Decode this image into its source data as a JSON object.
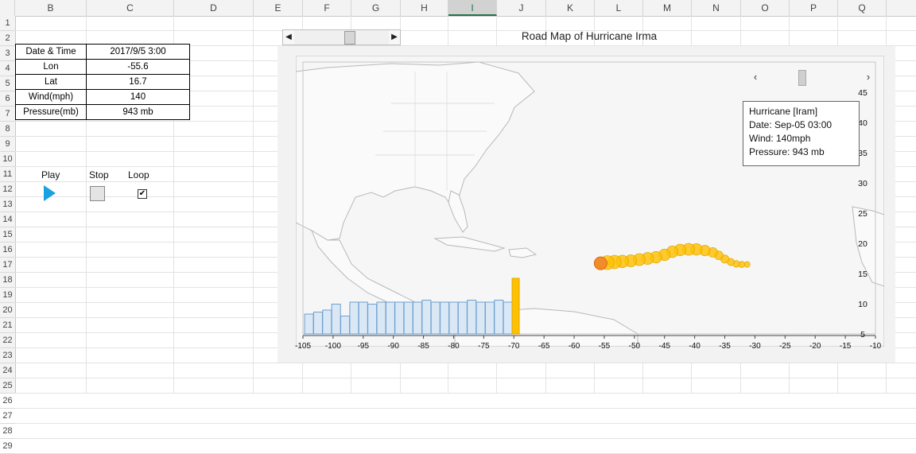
{
  "columns": [
    "B",
    "C",
    "D",
    "E",
    "F",
    "G",
    "H",
    "I",
    "J",
    "K",
    "L",
    "M",
    "N",
    "O",
    "P",
    "Q"
  ],
  "selected_column": "I",
  "rows": [
    "1",
    "2",
    "3",
    "4",
    "5",
    "6",
    "7",
    "8",
    "9",
    "10",
    "11",
    "12",
    "13",
    "14",
    "15",
    "16",
    "17",
    "18",
    "19",
    "20",
    "21",
    "22",
    "23",
    "24",
    "25",
    "26",
    "27",
    "28",
    "29"
  ],
  "info_table": [
    {
      "label": "Date & Time",
      "value": "2017/9/5 3:00"
    },
    {
      "label": "Lon",
      "value": "-55.6"
    },
    {
      "label": "Lat",
      "value": "16.7"
    },
    {
      "label": "Wind(mph)",
      "value": "140"
    },
    {
      "label": "Pressure(mb)",
      "value": "943 mb"
    }
  ],
  "controls": {
    "play_label": "Play",
    "stop_label": "Stop",
    "loop_label": "Loop",
    "loop_checked_glyph": "✔"
  },
  "chart": {
    "title": "Road Map of Hurricane Irma"
  },
  "tooltip": {
    "line1": "Hurricane [Iram]",
    "line2": "Date: Sep-05 03:00",
    "line3": "Wind: 140mph",
    "line4": "Pressure: 943 mb"
  },
  "colors": {
    "track": "#ffc000",
    "current": "#f28c28",
    "bars": "#dae8f5",
    "bar_current": "#ffc000",
    "play": "#1ba1e2"
  },
  "chart_data": {
    "type": "scatter",
    "title": "Road Map of Hurricane Irma",
    "xlim": [
      -105,
      -10
    ],
    "ylim": [
      5,
      50
    ],
    "x_ticks": [
      "-105",
      "-100",
      "-95",
      "-90",
      "-85",
      "-80",
      "-75",
      "-70",
      "-65",
      "-60",
      "-55",
      "-50",
      "-45",
      "-40",
      "-35",
      "-30",
      "-25",
      "-20",
      "-15",
      "-10"
    ],
    "y_ticks": [
      "5",
      "10",
      "15",
      "20",
      "25",
      "30",
      "35",
      "40",
      "45"
    ],
    "series": [
      {
        "points": [
          [
            -31.3,
            16.5
          ],
          [
            -32.2,
            16.5
          ],
          [
            -33.1,
            16.6
          ],
          [
            -34.0,
            16.9
          ],
          [
            -35.0,
            17.4
          ],
          [
            -36.0,
            18.0
          ],
          [
            -37.0,
            18.5
          ],
          [
            -38.3,
            18.8
          ],
          [
            -39.7,
            19.0
          ],
          [
            -41.0,
            19.0
          ],
          [
            -42.4,
            18.9
          ],
          [
            -43.7,
            18.6
          ],
          [
            -45.0,
            18.1
          ],
          [
            -46.4,
            17.7
          ],
          [
            -47.8,
            17.5
          ],
          [
            -49.2,
            17.3
          ],
          [
            -50.6,
            17.1
          ],
          [
            -52.0,
            17.0
          ],
          [
            -53.3,
            16.9
          ],
          [
            -54.5,
            16.8
          ]
        ],
        "sizes_mph": [
          50,
          55,
          60,
          65,
          75,
          80,
          90,
          100,
          110,
          115,
          110,
          110,
          110,
          110,
          115,
          115,
          115,
          120,
          130,
          135
        ]
      }
    ],
    "current": {
      "lon": -55.6,
      "lat": 16.7,
      "wind": 140
    },
    "bars": {
      "x": [
        -104,
        -102.5,
        -101,
        -99.5,
        -98,
        -96.5,
        -95,
        -93.5,
        -92,
        -90.5,
        -89,
        -87.5,
        -86,
        -84.5,
        -83,
        -81.5,
        -80,
        -78.5,
        -77,
        -75.5,
        -74,
        -72.5,
        -71,
        -69.7
      ],
      "values": [
        50,
        55,
        60,
        75,
        45,
        80,
        80,
        75,
        80,
        80,
        80,
        80,
        80,
        85,
        80,
        80,
        80,
        80,
        85,
        80,
        80,
        85,
        80,
        140
      ],
      "highlight_index": 23,
      "max": 160
    }
  }
}
